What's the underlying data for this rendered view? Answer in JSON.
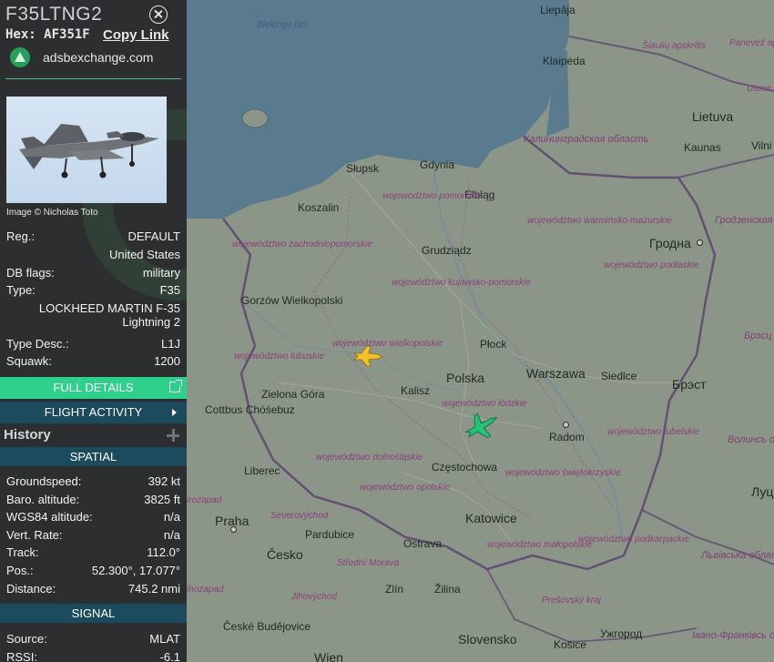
{
  "sidebar": {
    "callsign": "F35LTNG2",
    "hex_label": "Hex:",
    "hex_value": "AF351F",
    "copy_link": "Copy Link",
    "source": "adsbexchange.com",
    "photo_credit": "Image © Nicholas Toto",
    "info": {
      "reg_label": "Reg.:",
      "reg_value": "DEFAULT",
      "country": "United States",
      "dbflags_label": "DB flags:",
      "dbflags_value": "military",
      "type_label": "Type:",
      "type_value": "F35",
      "type_full_1": "LOCKHEED MARTIN F-35",
      "type_full_2": "Lightning 2",
      "typedesc_label": "Type Desc.:",
      "typedesc_value": "L1J",
      "squawk_label": "Squawk:",
      "squawk_value": "1200"
    },
    "buttons": {
      "full_details": "FULL DETAILS",
      "flight_activity": "FLIGHT ACTIVITY"
    },
    "history_label": "History",
    "spatial": {
      "header": "SPATIAL",
      "rows": [
        {
          "label": "Groundspeed:",
          "value": "392 kt"
        },
        {
          "label": "Baro. altitude:",
          "value": "3825 ft"
        },
        {
          "label": "WGS84 altitude:",
          "value": "n/a"
        },
        {
          "label": "Vert. Rate:",
          "value": "n/a"
        },
        {
          "label": "Track:",
          "value": "112.0°"
        },
        {
          "label": "Pos.:",
          "value": "52.300°, 17.077°"
        },
        {
          "label": "Distance:",
          "value": "745.2 nmi"
        }
      ]
    },
    "signal": {
      "header": "SIGNAL",
      "rows": [
        {
          "label": "Source:",
          "value": "MLAT"
        },
        {
          "label": "RSSI:",
          "value": "-6.1"
        }
      ]
    }
  },
  "map": {
    "labels": {
      "liepaja": "Liepāja",
      "klaipeda": "Klaipėda",
      "lietuva": "Lietuva",
      "kaunas": "Kaunas",
      "vilnius": "Vilni",
      "siauliu": "Šiaulių apskritis",
      "panevezio": "Panevėž apskrit",
      "utena": "Utene",
      "blekinge": "Blekinge län",
      "kaliningrad": "Калининградская область",
      "slupsk": "Słupsk",
      "gdynia": "Gdynia",
      "elblag": "Elbląg",
      "koszalin": "Koszalin",
      "pomorskie": "województwo pomorskie",
      "warminsko": "województwo warmińsko-mazurskie",
      "grodno_obl": "Гродзенская вобласць",
      "grodno": "Гродна",
      "zachodnio": "województwo zachodniopomorskie",
      "grudziadz": "Grudziądz",
      "podlaskie": "województwo podlaskie",
      "kujawsko": "województwo kujawsko-pomorskie",
      "gorzow": "Gorzów Wielkopolski",
      "lubuskie": "województwo lubuskie",
      "wielkopolskie": "województwo wielkopolskie",
      "plock": "Płock",
      "brest_obl": "Брэсц вобла",
      "polska": "Polska",
      "warszawa": "Warszawa",
      "siedlce": "Siedlce",
      "brest": "Брэст",
      "zielona": "Zielona Góra",
      "cottbus": "Cottbus Chóśebuz",
      "kalisz": "Kalisz",
      "lodzkie": "województwo łódzkie",
      "radom": "Radom",
      "lubelskie": "województwo lubelskie",
      "volyn": "Волинсь област",
      "dolnoslaskie": "województwo dolnośląskie",
      "liberec": "Liberec",
      "czestochowa": "Częstochowa",
      "swietokrzyskie": "województwo świętokrzyskie",
      "luck": "Луц",
      "opolskie": "województwo opolskie",
      "jirozapad": "irozapad",
      "severovychod": "Severovýchod",
      "praha": "Praha",
      "pardubice": "Pardubice",
      "katowice": "Katowice",
      "ostrava": "Ostrava",
      "malopolskie": "województwo małopolskie",
      "podkarpackie": "województwo podkarpackie",
      "lviv_obl": "Львівська область",
      "cesko": "Česko",
      "stredni_morava": "Střední Morava",
      "jihozapad": "ihozapad",
      "jihovychod": "Jihovýchod",
      "zlin": "Zlín",
      "zilina": "Žilina",
      "presovsky": "Prešovský kraj",
      "ceske_budejovice": "České Budějovice",
      "slovensko": "Slovensko",
      "uzhgorod": "Ужгород",
      "kosice": "Košice",
      "ivano": "Івано-Франківсь область",
      "wien": "Wien"
    }
  }
}
